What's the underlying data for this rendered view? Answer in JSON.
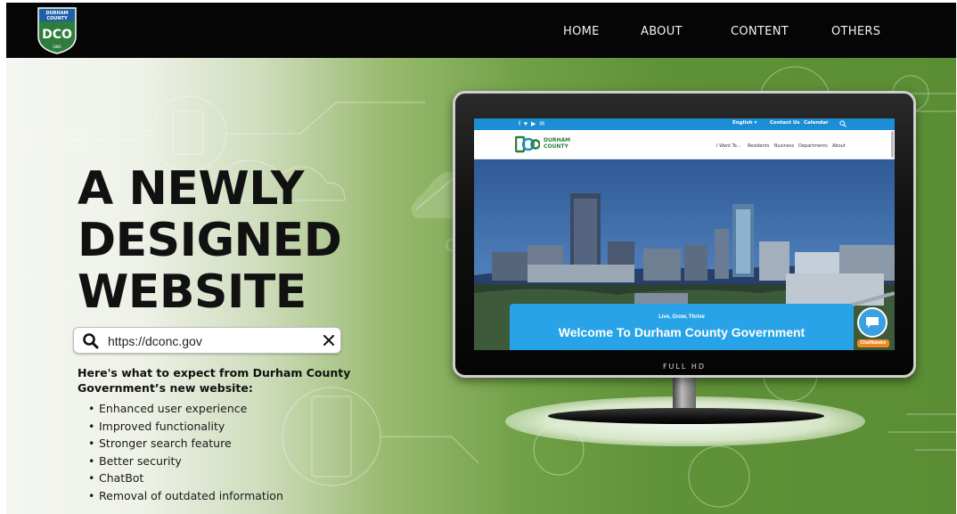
{
  "navbar": {
    "logo_lines": [
      "DURHAM",
      "COUNTY"
    ],
    "logo_mark": "DCO",
    "logo_year": "1881",
    "items": [
      {
        "label": "HOME"
      },
      {
        "label": "ABOUT"
      },
      {
        "label": "CONTENT"
      },
      {
        "label": "OTHERS"
      }
    ]
  },
  "hero": {
    "headline_lines": [
      "A NEWLY",
      "DESIGNED",
      "WEBSITE"
    ],
    "search": {
      "value": "https://dconc.gov",
      "icon": "search-icon",
      "clear_icon": "close-icon"
    },
    "intro": "Here's what to expect from Durham County Government’s new website:",
    "features": [
      "Enhanced user experience",
      "Improved functionality",
      "Stronger search feature",
      "Better security",
      "ChatBot",
      "Removal of outdated information"
    ]
  },
  "monitor": {
    "badge": "FULL HD",
    "site": {
      "social_icons": "f ♥ ▶ ✉",
      "top_links": [
        "English ▾",
        "Contact Us",
        "Calendar"
      ],
      "logo_text_lines": [
        "DURHAM",
        "COUNTY"
      ],
      "nav": [
        "I Want To...",
        "Residents",
        "Business",
        "Departments",
        "About"
      ],
      "card_tag": "Live, Grow, Thrive",
      "card_title": "Welcome To Durham County Government",
      "chatbot_label": "ChatNatalee"
    }
  },
  "colors": {
    "nav_bg": "#050505",
    "hero_green": "#5f9138",
    "site_blue": "#1b8ed6",
    "card_blue": "#29a3e8",
    "logo_green": "#2a7d3b"
  }
}
